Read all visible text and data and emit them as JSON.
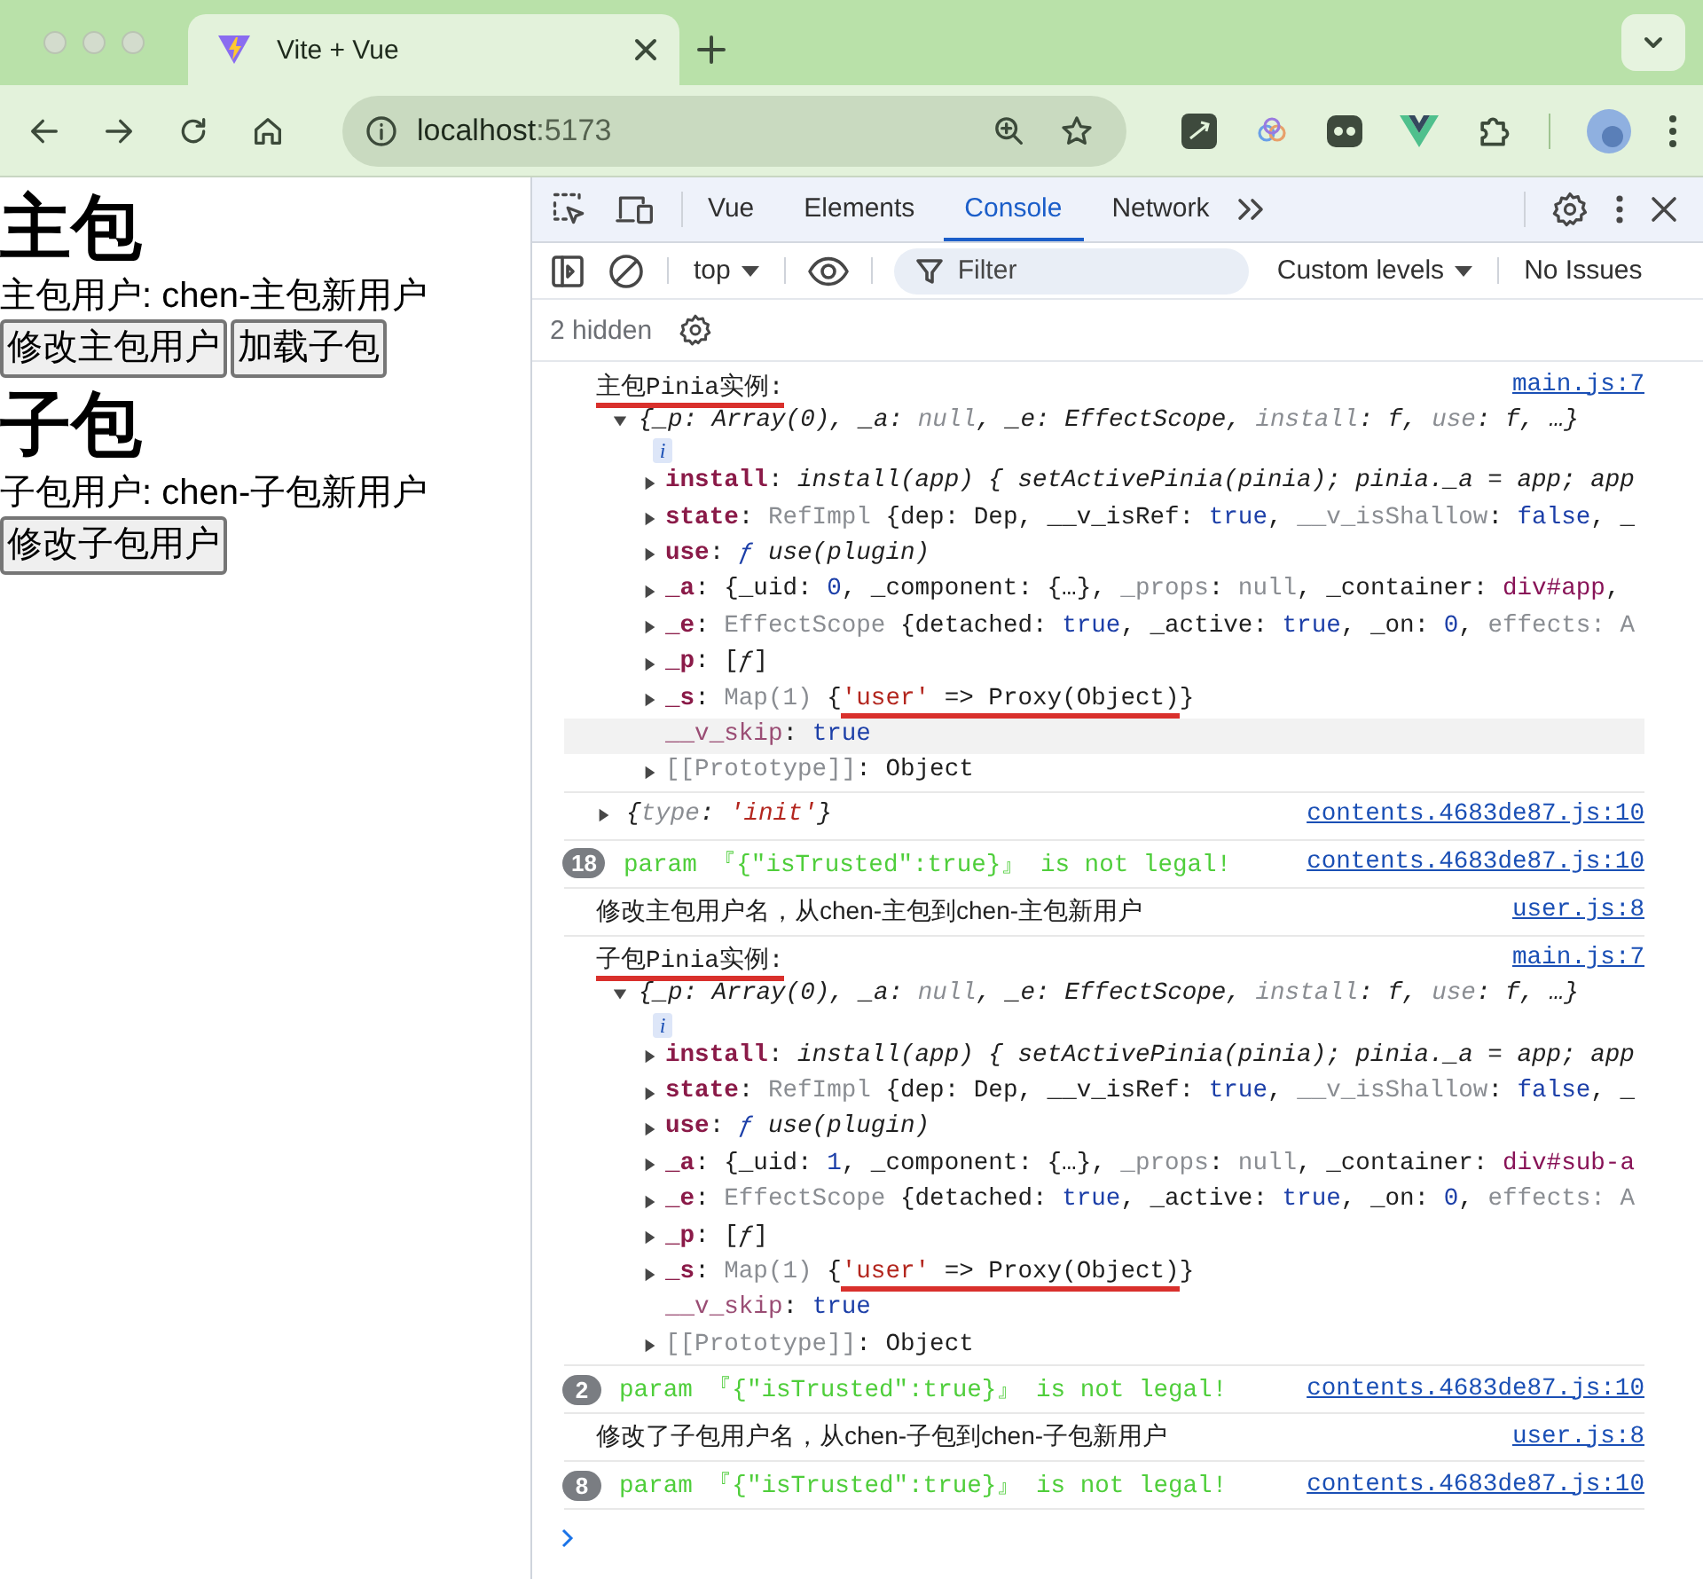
{
  "browser": {
    "tab": {
      "title": "Vite + Vue",
      "selected": true
    },
    "url_host": "localhost",
    "url_port": ":5173"
  },
  "page": {
    "sections": [
      {
        "title": "主包",
        "user": "主包用户: chen-主包新用户",
        "buttons": [
          "修改主包用户",
          "加载子包"
        ]
      },
      {
        "title": "子包",
        "user": "子包用户: chen-子包新用户",
        "buttons": [
          "修改子包用户"
        ]
      }
    ]
  },
  "devtools": {
    "tabs": [
      {
        "label": "Vue",
        "selected": false
      },
      {
        "label": "Elements",
        "selected": false
      },
      {
        "label": "Console",
        "selected": true
      },
      {
        "label": "Network",
        "selected": false
      }
    ],
    "context": "top",
    "filter_placeholder": "Filter",
    "levels": "Custom levels",
    "issues": "No Issues",
    "hidden": "2 hidden",
    "entries": [
      {
        "kind": "instance",
        "header": "主包Pinia实例:",
        "underlined": true,
        "source": "main.js:7",
        "expanded": true,
        "badge": "i",
        "preview": [
          {
            "kind": "plain",
            "text": "{_p: Array(0), _a: "
          },
          {
            "kind": "dim",
            "text": "null"
          },
          {
            "kind": "plain",
            "text": ", _e: EffectScope, "
          },
          {
            "kind": "dim",
            "text": "install"
          },
          {
            "kind": "plain",
            "text": ": f, "
          },
          {
            "kind": "dim",
            "text": "use"
          },
          {
            "kind": "plain",
            "text": ": f, …}"
          }
        ],
        "properties": [
          {
            "expandable": true,
            "highlighted": false,
            "tokens": [
              {
                "kind": "key",
                "text": "install"
              },
              {
                "kind": "plain",
                "text": ": "
              },
              {
                "kind": "ital",
                "text": "install(app) { setActivePinia(pinia); pinia._a = app; app"
              }
            ]
          },
          {
            "expandable": true,
            "highlighted": false,
            "tokens": [
              {
                "kind": "key",
                "text": "state"
              },
              {
                "kind": "plain",
                "text": ": "
              },
              {
                "kind": "dim",
                "text": "RefImpl "
              },
              {
                "kind": "plain",
                "text": "{dep: Dep, __v_isRef: "
              },
              {
                "kind": "blue",
                "text": "true"
              },
              {
                "kind": "plain",
                "text": ", "
              },
              {
                "kind": "dim",
                "text": "__v_isShallow"
              },
              {
                "kind": "plain",
                "text": ": "
              },
              {
                "kind": "blue",
                "text": "false"
              },
              {
                "kind": "plain",
                "text": ", _"
              }
            ]
          },
          {
            "expandable": true,
            "highlighted": false,
            "tokens": [
              {
                "kind": "key",
                "text": "use"
              },
              {
                "kind": "plain",
                "text": ": "
              },
              {
                "kind": "fn",
                "text": "ƒ"
              },
              {
                "kind": "ital",
                "text": " use(plugin)"
              }
            ]
          },
          {
            "expandable": true,
            "highlighted": false,
            "tokens": [
              {
                "kind": "key",
                "text": "_a"
              },
              {
                "kind": "plain",
                "text": ": {_uid: "
              },
              {
                "kind": "blue",
                "text": "0"
              },
              {
                "kind": "plain",
                "text": ", _component: {…}, "
              },
              {
                "kind": "dim",
                "text": "_props"
              },
              {
                "kind": "plain",
                "text": ": "
              },
              {
                "kind": "dim",
                "text": "null"
              },
              {
                "kind": "plain",
                "text": ", _container: "
              },
              {
                "kind": "tag",
                "text": "div#app"
              },
              {
                "kind": "plain",
                "text": ","
              }
            ]
          },
          {
            "expandable": true,
            "highlighted": false,
            "tokens": [
              {
                "kind": "key",
                "text": "_e"
              },
              {
                "kind": "plain",
                "text": ": "
              },
              {
                "kind": "dim",
                "text": "EffectScope "
              },
              {
                "kind": "plain",
                "text": "{detached: "
              },
              {
                "kind": "blue",
                "text": "true"
              },
              {
                "kind": "plain",
                "text": ", _active: "
              },
              {
                "kind": "blue",
                "text": "true"
              },
              {
                "kind": "plain",
                "text": ", _on: "
              },
              {
                "kind": "blue",
                "text": "0"
              },
              {
                "kind": "plain",
                "text": ", "
              },
              {
                "kind": "dim",
                "text": "effects: A"
              }
            ]
          },
          {
            "expandable": true,
            "highlighted": false,
            "tokens": [
              {
                "kind": "key",
                "text": "_p"
              },
              {
                "kind": "plain",
                "text": ": ["
              },
              {
                "kind": "ital",
                "text": "ƒ"
              },
              {
                "kind": "plain",
                "text": "]"
              }
            ]
          },
          {
            "expandable": true,
            "highlighted": false,
            "tokens": [
              {
                "kind": "key",
                "text": "_s"
              },
              {
                "kind": "plain",
                "text": ": "
              },
              {
                "kind": "dim",
                "text": "Map(1) "
              },
              {
                "kind": "plain",
                "text": "{"
              },
              {
                "kind": "str",
                "text": "'user'",
                "underlined": true
              },
              {
                "kind": "plain",
                "text": " => Proxy(Object)",
                "underlined": true
              },
              {
                "kind": "plain",
                "text": "}"
              }
            ]
          },
          {
            "expandable": false,
            "highlighted": true,
            "tokens": [
              {
                "kind": "hiddenkey",
                "text": "__v_skip"
              },
              {
                "kind": "plain",
                "text": ": "
              },
              {
                "kind": "blue",
                "text": "true"
              }
            ]
          },
          {
            "expandable": true,
            "highlighted": false,
            "tokens": [
              {
                "kind": "internalkey",
                "text": "[[Prototype]]"
              },
              {
                "kind": "plain",
                "text": ": Object"
              }
            ]
          }
        ]
      },
      {
        "kind": "object",
        "expanded": false,
        "source": "contents.4683de87.js:10",
        "tokens": [
          {
            "kind": "plain",
            "text": "{"
          },
          {
            "kind": "dim",
            "text": "type"
          },
          {
            "kind": "plain",
            "text": ": "
          },
          {
            "kind": "str",
            "text": "'init'"
          },
          {
            "kind": "plain",
            "text": "}"
          }
        ]
      },
      {
        "kind": "repeat",
        "count": "18",
        "text": "param 『{\"isTrusted\":true}』 is not legal!",
        "source": "contents.4683de87.js:10"
      },
      {
        "kind": "log",
        "text": "修改主包用户名，从chen-主包到chen-主包新用户",
        "source": "user.js:8"
      },
      {
        "kind": "instance",
        "header": "子包Pinia实例:",
        "underlined": true,
        "source": "main.js:7",
        "expanded": true,
        "badge": "i",
        "preview": [
          {
            "kind": "plain",
            "text": "{_p: Array(0), _a: "
          },
          {
            "kind": "dim",
            "text": "null"
          },
          {
            "kind": "plain",
            "text": ", _e: EffectScope, "
          },
          {
            "kind": "dim",
            "text": "install"
          },
          {
            "kind": "plain",
            "text": ": f, "
          },
          {
            "kind": "dim",
            "text": "use"
          },
          {
            "kind": "plain",
            "text": ": f, …}"
          }
        ],
        "properties": [
          {
            "expandable": true,
            "highlighted": false,
            "tokens": [
              {
                "kind": "key",
                "text": "install"
              },
              {
                "kind": "plain",
                "text": ": "
              },
              {
                "kind": "ital",
                "text": "install(app) { setActivePinia(pinia); pinia._a = app; app"
              }
            ]
          },
          {
            "expandable": true,
            "highlighted": false,
            "tokens": [
              {
                "kind": "key",
                "text": "state"
              },
              {
                "kind": "plain",
                "text": ": "
              },
              {
                "kind": "dim",
                "text": "RefImpl "
              },
              {
                "kind": "plain",
                "text": "{dep: Dep, __v_isRef: "
              },
              {
                "kind": "blue",
                "text": "true"
              },
              {
                "kind": "plain",
                "text": ", "
              },
              {
                "kind": "dim",
                "text": "__v_isShallow"
              },
              {
                "kind": "plain",
                "text": ": "
              },
              {
                "kind": "blue",
                "text": "false"
              },
              {
                "kind": "plain",
                "text": ", _"
              }
            ]
          },
          {
            "expandable": true,
            "highlighted": false,
            "tokens": [
              {
                "kind": "key",
                "text": "use"
              },
              {
                "kind": "plain",
                "text": ": "
              },
              {
                "kind": "fn",
                "text": "ƒ"
              },
              {
                "kind": "ital",
                "text": " use(plugin)"
              }
            ]
          },
          {
            "expandable": true,
            "highlighted": false,
            "tokens": [
              {
                "kind": "key",
                "text": "_a"
              },
              {
                "kind": "plain",
                "text": ": {_uid: "
              },
              {
                "kind": "blue",
                "text": "1"
              },
              {
                "kind": "plain",
                "text": ", _component: {…}, "
              },
              {
                "kind": "dim",
                "text": "_props"
              },
              {
                "kind": "plain",
                "text": ": "
              },
              {
                "kind": "dim",
                "text": "null"
              },
              {
                "kind": "plain",
                "text": ", _container: "
              },
              {
                "kind": "tag",
                "text": "div#sub-a"
              }
            ]
          },
          {
            "expandable": true,
            "highlighted": false,
            "tokens": [
              {
                "kind": "key",
                "text": "_e"
              },
              {
                "kind": "plain",
                "text": ": "
              },
              {
                "kind": "dim",
                "text": "EffectScope "
              },
              {
                "kind": "plain",
                "text": "{detached: "
              },
              {
                "kind": "blue",
                "text": "true"
              },
              {
                "kind": "plain",
                "text": ", _active: "
              },
              {
                "kind": "blue",
                "text": "true"
              },
              {
                "kind": "plain",
                "text": ", _on: "
              },
              {
                "kind": "blue",
                "text": "0"
              },
              {
                "kind": "plain",
                "text": ", "
              },
              {
                "kind": "dim",
                "text": "effects: A"
              }
            ]
          },
          {
            "expandable": true,
            "highlighted": false,
            "tokens": [
              {
                "kind": "key",
                "text": "_p"
              },
              {
                "kind": "plain",
                "text": ": ["
              },
              {
                "kind": "ital",
                "text": "ƒ"
              },
              {
                "kind": "plain",
                "text": "]"
              }
            ]
          },
          {
            "expandable": true,
            "highlighted": false,
            "tokens": [
              {
                "kind": "key",
                "text": "_s"
              },
              {
                "kind": "plain",
                "text": ": "
              },
              {
                "kind": "dim",
                "text": "Map(1) "
              },
              {
                "kind": "plain",
                "text": "{"
              },
              {
                "kind": "str",
                "text": "'user'",
                "underlined": true
              },
              {
                "kind": "plain",
                "text": " => Proxy(Object)",
                "underlined": true
              },
              {
                "kind": "plain",
                "text": "}"
              }
            ]
          },
          {
            "expandable": false,
            "highlighted": false,
            "tokens": [
              {
                "kind": "hiddenkey",
                "text": "__v_skip"
              },
              {
                "kind": "plain",
                "text": ": "
              },
              {
                "kind": "blue",
                "text": "true"
              }
            ]
          },
          {
            "expandable": true,
            "highlighted": false,
            "tokens": [
              {
                "kind": "internalkey",
                "text": "[[Prototype]]"
              },
              {
                "kind": "plain",
                "text": ": Object"
              }
            ]
          }
        ]
      },
      {
        "kind": "repeat",
        "count": "2",
        "text": "param 『{\"isTrusted\":true}』 is not legal!",
        "source": "contents.4683de87.js:10"
      },
      {
        "kind": "log",
        "text": "修改了子包用户名，从chen-子包到chen-子包新用户",
        "source": "user.js:8"
      },
      {
        "kind": "repeat",
        "count": "8",
        "text": "param 『{\"isTrusted\":true}』 is not legal!",
        "source": "contents.4683de87.js:10"
      }
    ]
  }
}
